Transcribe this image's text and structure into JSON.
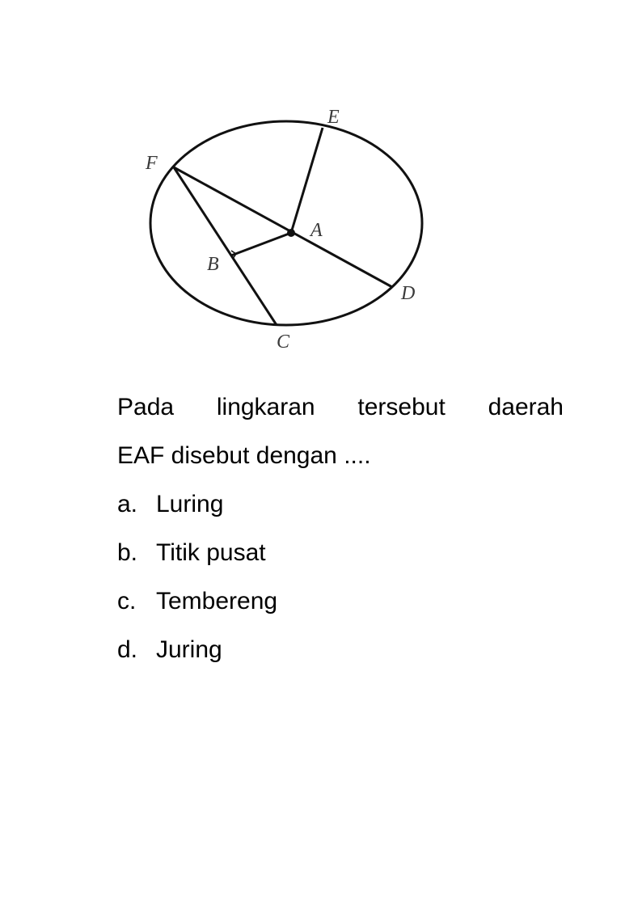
{
  "figure": {
    "points": {
      "E": "E",
      "F": "F",
      "A": "A",
      "B": "B",
      "C": "C",
      "D": "D"
    }
  },
  "question": {
    "words_line1": [
      "Pada",
      "lingkaran",
      "tersebut",
      "daerah"
    ],
    "line2": "EAF disebut dengan ...."
  },
  "options": [
    {
      "letter": "a.",
      "text": "Luring"
    },
    {
      "letter": "b.",
      "text": "Titik pusat"
    },
    {
      "letter": "c.",
      "text": "Tembereng"
    },
    {
      "letter": "d.",
      "text": "Juring"
    }
  ]
}
